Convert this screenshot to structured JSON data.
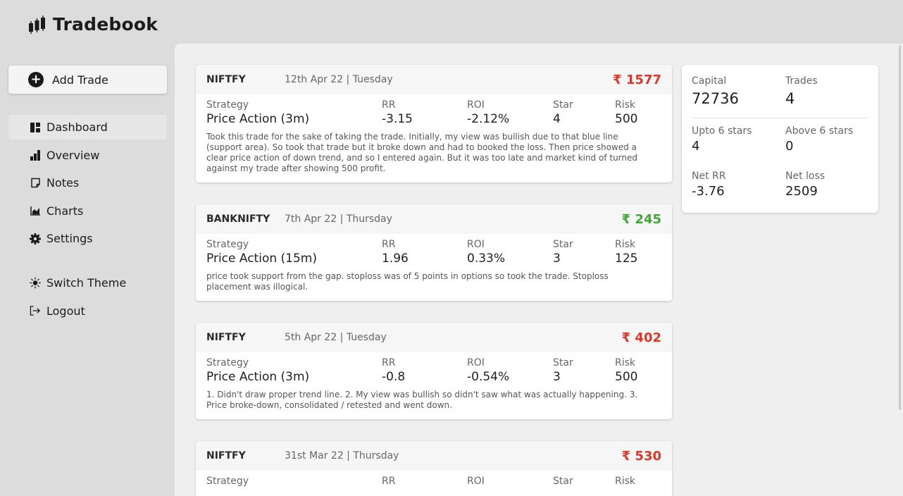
{
  "app": {
    "title": "Tradebook"
  },
  "sidebar": {
    "add_trade_label": "Add Trade",
    "nav": [
      {
        "label": "Dashboard",
        "icon": "dashboard-icon",
        "active": true
      },
      {
        "label": "Overview",
        "icon": "bar-chart-icon",
        "active": false
      },
      {
        "label": "Notes",
        "icon": "note-icon",
        "active": false
      },
      {
        "label": "Charts",
        "icon": "area-chart-icon",
        "active": false
      },
      {
        "label": "Settings",
        "icon": "gear-icon",
        "active": false
      }
    ],
    "secondary": [
      {
        "label": "Switch Theme",
        "icon": "sun-icon"
      },
      {
        "label": "Logout",
        "icon": "logout-icon"
      }
    ]
  },
  "labels": {
    "strategy": "Strategy",
    "rr": "RR",
    "roi": "ROI",
    "star": "Star",
    "risk": "Risk"
  },
  "currency": "₹",
  "colors": {
    "loss": "#d53a2c",
    "profit": "#45a33a"
  },
  "trades": [
    {
      "symbol": "NIFTFY",
      "date": "12th Apr 22 | Tuesday",
      "pnl": "₹ 1577",
      "pnl_type": "loss",
      "strategy": "Price Action (3m)",
      "rr": "-3.15",
      "roi": "-2.12%",
      "star": "4",
      "risk": "500",
      "note": "Took this trade for the sake of taking the trade. Initially, my view was bullish due to that blue line (support area). So took that trade but it broke down and had to booked the loss. Then price showed a clear price action of down trend, and so I entered again. But it was too late and market kind of turned against my trade after showing 500 profit."
    },
    {
      "symbol": "BANKNIFTY",
      "date": "7th Apr 22 | Thursday",
      "pnl": "₹ 245",
      "pnl_type": "profit",
      "strategy": "Price Action (15m)",
      "rr": "1.96",
      "roi": "0.33%",
      "star": "3",
      "risk": "125",
      "note": "price took support from the gap. stoploss was of 5 points in options so took the trade. Stoploss placement was illogical."
    },
    {
      "symbol": "NIFTFY",
      "date": "5th Apr 22 | Tuesday",
      "pnl": "₹ 402",
      "pnl_type": "loss",
      "strategy": "Price Action (3m)",
      "rr": "-0.8",
      "roi": "-0.54%",
      "star": "3",
      "risk": "500",
      "note": "1. Didn't draw proper trend line. 2. My view was bullish so didn't saw what was actually happening. 3. Price broke-down, consolidated / retested and went down."
    },
    {
      "symbol": "NIFTFY",
      "date": "31st Mar 22 | Thursday",
      "pnl": "₹ 530",
      "pnl_type": "loss",
      "strategy": "",
      "rr": "",
      "roi": "",
      "star": "",
      "risk": "",
      "note": ""
    }
  ],
  "summary": {
    "capital_label": "Capital",
    "capital": "72736",
    "trades_label": "Trades",
    "trades": "4",
    "upto6_label": "Upto 6 stars",
    "upto6": "4",
    "above6_label": "Above 6 stars",
    "above6": "0",
    "netrr_label": "Net RR",
    "netrr": "-3.76",
    "netloss_label": "Net loss",
    "netloss": "2509"
  }
}
